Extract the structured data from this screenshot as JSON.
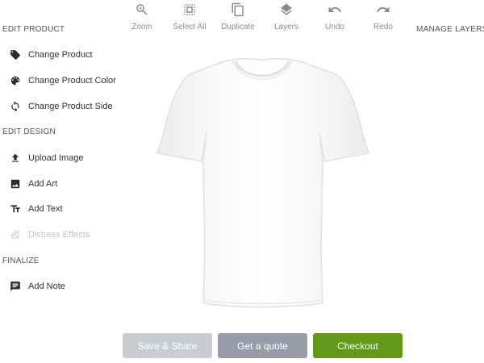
{
  "toolbar": {
    "items": [
      {
        "label": "Zoom",
        "icon": "zoom-icon"
      },
      {
        "label": "Select All",
        "icon": "select-all-icon"
      },
      {
        "label": "Duplicate",
        "icon": "duplicate-icon"
      },
      {
        "label": "Layers",
        "icon": "layers-icon"
      },
      {
        "label": "Undo",
        "icon": "undo-icon"
      },
      {
        "label": "Redo",
        "icon": "redo-icon"
      }
    ],
    "manage_layers": "MANAGE LAYERS"
  },
  "sidebar": {
    "edit_product": {
      "title": "EDIT PRODUCT",
      "items": [
        {
          "label": "Change Product",
          "icon": "tag-icon"
        },
        {
          "label": "Change Product Color",
          "icon": "palette-icon"
        },
        {
          "label": "Change Product Side",
          "icon": "rotate-icon"
        }
      ]
    },
    "edit_design": {
      "title": "EDIT DESIGN",
      "items": [
        {
          "label": "Upload Image",
          "icon": "upload-icon"
        },
        {
          "label": "Add Art",
          "icon": "image-icon"
        },
        {
          "label": "Add Text",
          "icon": "text-icon"
        },
        {
          "label": "Distress Effects",
          "icon": "distress-icon",
          "disabled": true
        }
      ]
    },
    "finalize": {
      "title": "FINALIZE",
      "items": [
        {
          "label": "Add Note",
          "icon": "note-icon"
        }
      ]
    }
  },
  "actions": {
    "save_share": "Save & Share",
    "get_quote": "Get a quote",
    "checkout": "Checkout"
  },
  "colors": {
    "save_share_bg": "#c9ccd1",
    "get_quote_bg": "#9a9ba9",
    "checkout_bg": "#63991b",
    "product_color": "#ffffff"
  }
}
